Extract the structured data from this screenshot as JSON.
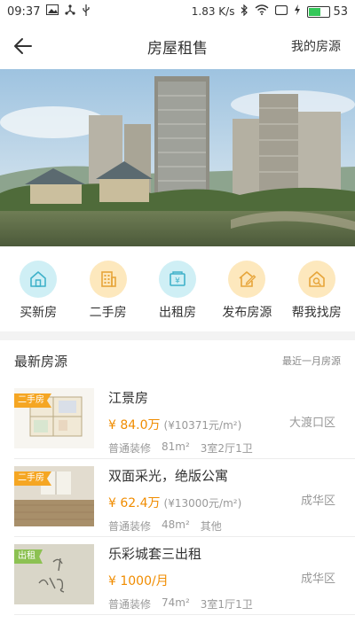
{
  "status_bar": {
    "time": "09:37",
    "network_speed": "1.83 K/s",
    "battery": "53"
  },
  "nav": {
    "title": "房屋租售",
    "right_label": "我的房源"
  },
  "menu": [
    {
      "label": "买新房",
      "icon": "home-icon",
      "color": "blue"
    },
    {
      "label": "二手房",
      "icon": "building-icon",
      "color": "yellow"
    },
    {
      "label": "出租房",
      "icon": "rent-icon",
      "color": "blue"
    },
    {
      "label": "发布房源",
      "icon": "publish-icon",
      "color": "yellow"
    },
    {
      "label": "帮我找房",
      "icon": "find-house-icon",
      "color": "yellow"
    }
  ],
  "section": {
    "title": "最新房源",
    "more": "最近一月房源"
  },
  "listings": [
    {
      "tag": "二手房",
      "title": "江景房",
      "price": "¥ 84.0万",
      "unit_price": "(¥10371元/m²)",
      "district": "大渡口区",
      "decoration": "普通装修",
      "area": "81m²",
      "layout": "3室2厅1卫"
    },
    {
      "tag": "二手房",
      "title": "双面采光，绝版公寓",
      "price": "¥ 62.4万",
      "unit_price": "(¥13000元/m²)",
      "district": "成华区",
      "decoration": "普通装修",
      "area": "48m²",
      "layout": "其他"
    },
    {
      "tag": "出租",
      "title": "乐彩城套三出租",
      "price": "¥ 1000/月",
      "unit_price": "",
      "district": "成华区",
      "decoration": "普通装修",
      "area": "74m²",
      "layout": "3室1厅1卫"
    }
  ]
}
